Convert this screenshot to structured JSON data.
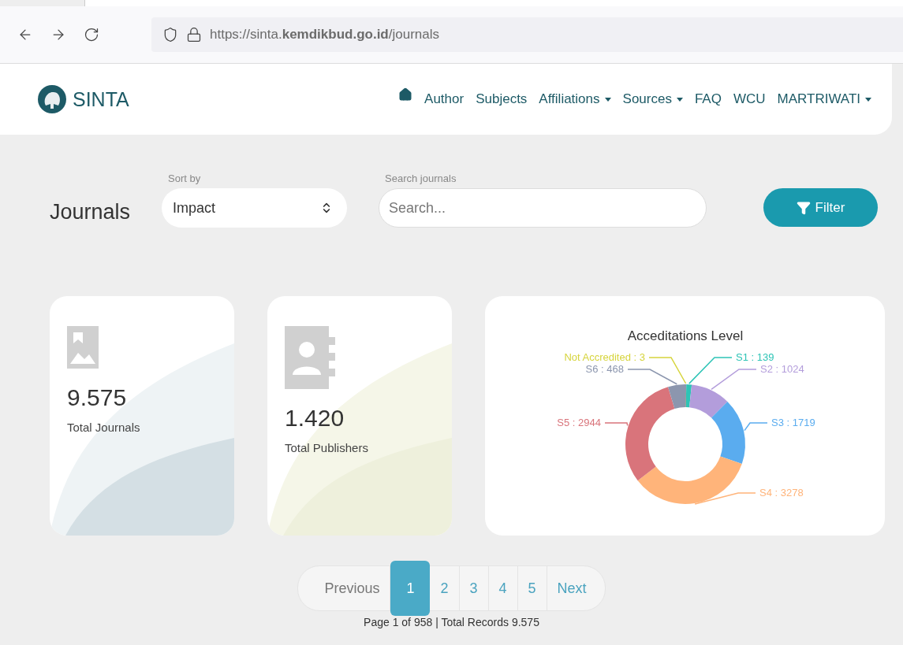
{
  "browser": {
    "url": "https://sinta.**kemdikbud.go.id**/journals"
  },
  "navbar": {
    "brand": "SINTA",
    "items": [
      {
        "label": "Author",
        "dropdown": false
      },
      {
        "label": "Subjects",
        "dropdown": false
      },
      {
        "label": "Affiliations",
        "dropdown": true
      },
      {
        "label": "Sources",
        "dropdown": true
      },
      {
        "label": "FAQ",
        "dropdown": false
      },
      {
        "label": "WCU",
        "dropdown": false
      },
      {
        "label": "MARTRIWATI",
        "dropdown": true
      }
    ]
  },
  "toolbar": {
    "title": "Journals",
    "sort_label": "Sort by",
    "sort_value": "Impact",
    "search_label": "Search journals",
    "search_placeholder": "Search...",
    "filter_button": "Filter"
  },
  "stats": [
    {
      "kind": "journals",
      "value": "9.575",
      "label": "Total Journals"
    },
    {
      "kind": "publishers",
      "value": "1.420",
      "label": "Total Publishers"
    }
  ],
  "accreditation": {
    "chart_data": {
      "type": "donut",
      "title": "Acceditations Level",
      "values": [
        3,
        139,
        1024,
        1719,
        3278,
        2944,
        468
      ],
      "colors": [
        "#d6d43c",
        "#2ec4b6",
        "#b39ddb",
        "#5aacef",
        "#ffb47a",
        "#d9747b",
        "#8c96ae"
      ],
      "value_labels": [
        "Not Accredited : 3",
        "S1 : 139",
        "S2 : 1024",
        "S3 : 1719",
        "S4 : 3278",
        "S5 : 2944",
        "S6 : 468"
      ]
    }
  },
  "pagination": {
    "previous": "Previous",
    "next": "Next",
    "pages": [
      {
        "label": "1",
        "selected": true
      },
      {
        "label": "2",
        "selected": false
      },
      {
        "label": "3",
        "selected": false
      },
      {
        "label": "4",
        "selected": false
      },
      {
        "label": "5",
        "selected": false
      }
    ],
    "info": "Page 1 of 958 | Total Records 9.575"
  }
}
